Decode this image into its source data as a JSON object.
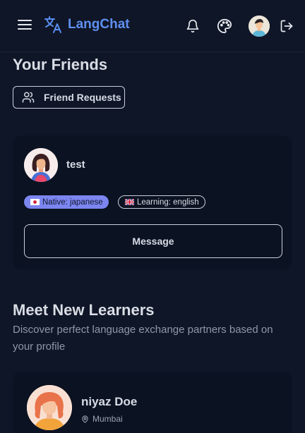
{
  "navbar": {
    "brand_name": "LangChat",
    "icons": [
      "menu-icon",
      "translate-icon",
      "bell-icon",
      "palette-icon",
      "logout-icon"
    ]
  },
  "friends": {
    "title": "Your Friends",
    "requests_label": "Friend Requests",
    "items": [
      {
        "name": "test",
        "native_label": "Native: japanese",
        "learning_label": "Learning: english",
        "message_label": "Message"
      }
    ]
  },
  "learners": {
    "title": "Meet New Learners",
    "subtitle": "Discover perfect language exchange partners based on your profile",
    "items": [
      {
        "name": "niyaz Doe",
        "location": "Mumbai"
      }
    ]
  },
  "colors": {
    "background": "#0f1627",
    "card": "#0b1221",
    "brand": "#5f8ff0",
    "native_badge": "#7b86f0"
  }
}
